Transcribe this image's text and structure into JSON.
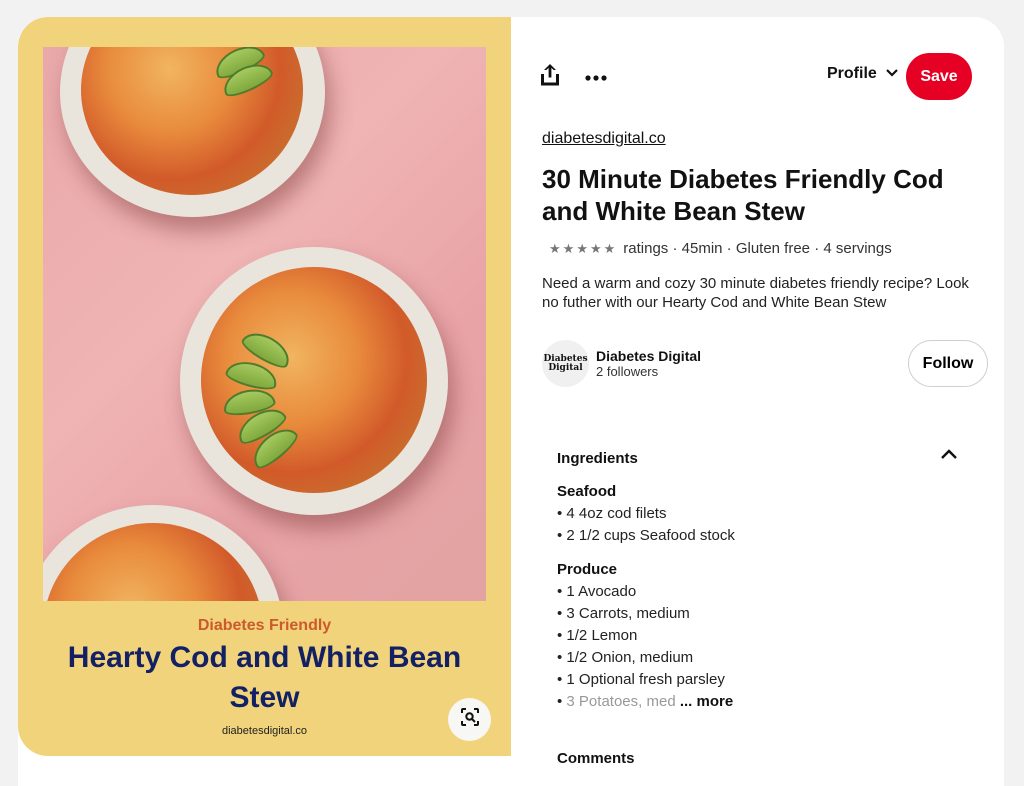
{
  "pin_image": {
    "caption_subtitle": "Diabetes Friendly",
    "caption_title": "Hearty Cod and White Bean Stew",
    "caption_site": "diabetesdigital.co",
    "background_color": "#f1d37c"
  },
  "toolbar": {
    "profile_label": "Profile",
    "save_label": "Save",
    "save_color": "#e60023"
  },
  "pin": {
    "source_link": "diabetesdigital.co",
    "title": "30 Minute Diabetes Friendly Cod and White Bean Stew",
    "rating_stars": 5,
    "meta": "ratings · 45min · Gluten free · 4 servings",
    "description": "Need a warm and cozy 30 minute diabetes friendly recipe? Look no futher with our Hearty Cod and White Bean Stew"
  },
  "author": {
    "avatar_line1": "Diabetes",
    "avatar_line2": "Digital",
    "name": "Diabetes Digital",
    "followers": "2 followers",
    "follow_label": "Follow"
  },
  "ingredients": {
    "header": "Ingredients",
    "groups": [
      {
        "title": "Seafood",
        "items": [
          "4 4oz cod filets",
          "2 1/2 cups Seafood stock"
        ]
      },
      {
        "title": "Produce",
        "items": [
          "1 Avocado",
          "3 Carrots, medium",
          "1/2 Lemon",
          "1/2 Onion, medium",
          "1 Optional fresh parsley",
          "3 Potatoes, med"
        ]
      }
    ],
    "more_label": "... more"
  },
  "comments": {
    "header": "Comments"
  }
}
